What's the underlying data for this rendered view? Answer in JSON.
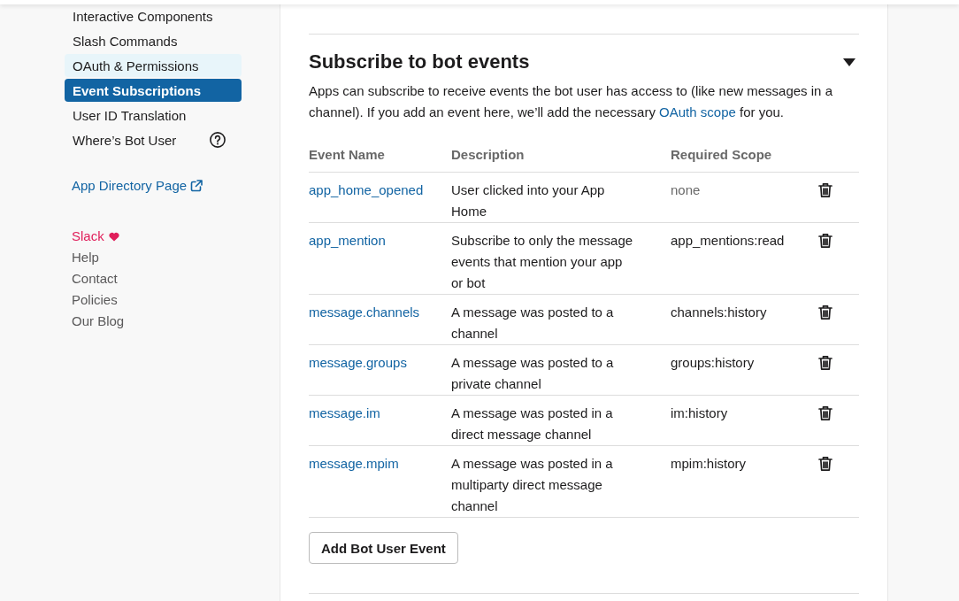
{
  "sidebar": {
    "items": [
      {
        "label": "Interactive Components",
        "selected": false,
        "hovered": false,
        "help": false
      },
      {
        "label": "Slash Commands",
        "selected": false,
        "hovered": false,
        "help": false
      },
      {
        "label": "OAuth & Permissions",
        "selected": false,
        "hovered": true,
        "help": false
      },
      {
        "label": "Event Subscriptions",
        "selected": true,
        "hovered": false,
        "help": false
      },
      {
        "label": "User ID Translation",
        "selected": false,
        "hovered": false,
        "help": false
      },
      {
        "label": "Where’s Bot User",
        "selected": false,
        "hovered": false,
        "help": true
      }
    ],
    "directory_link": {
      "label": "App Directory Page",
      "external": true
    },
    "footer_links": [
      {
        "label": "Slack",
        "kind": "brand"
      },
      {
        "label": "Help",
        "kind": "link"
      },
      {
        "label": "Contact",
        "kind": "link"
      },
      {
        "label": "Policies",
        "kind": "link"
      },
      {
        "label": "Our Blog",
        "kind": "link"
      }
    ]
  },
  "section": {
    "title": "Subscribe to bot events",
    "expanded": true,
    "description": {
      "text_before": "Apps can subscribe to receive events the bot user has access to (like new messages in a channel). If you add an event here, we’ll add the necessary ",
      "link": "OAuth scope",
      "text_after": " for you."
    },
    "table": {
      "columns": [
        "Event Name",
        "Description",
        "Required Scope"
      ],
      "rows": [
        {
          "event": "app_home_opened",
          "description": "User clicked into your App Home",
          "scope": "none",
          "scope_muted": true
        },
        {
          "event": "app_mention",
          "description": "Subscribe to only the message events that mention your app or bot",
          "scope": "app_mentions:read",
          "scope_muted": false
        },
        {
          "event": "message.channels",
          "description": "A message was posted to a channel",
          "scope": "channels:history",
          "scope_muted": false
        },
        {
          "event": "message.groups",
          "description": "A message was posted to a private channel",
          "scope": "groups:history",
          "scope_muted": false
        },
        {
          "event": "message.im",
          "description": "A message was posted in a direct message channel",
          "scope": "im:history",
          "scope_muted": false
        },
        {
          "event": "message.mpim",
          "description": "A message was posted in a multiparty direct message channel",
          "scope": "mpim:history",
          "scope_muted": false
        }
      ]
    },
    "add_button": "Add Bot User Event"
  }
}
